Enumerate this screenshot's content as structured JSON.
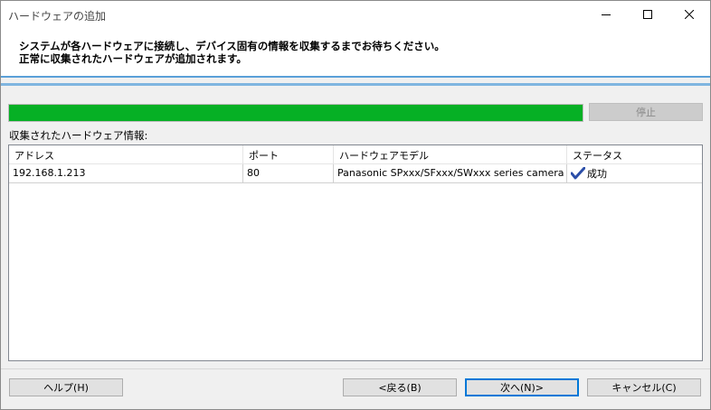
{
  "window": {
    "title": "ハードウェアの追加"
  },
  "header": {
    "line1": "システムが各ハードウェアに接続し、デバイス固有の情報を収集するまでお待ちください。",
    "line2": "正常に収集されたハードウェアが追加されます。"
  },
  "progress": {
    "percent": 100,
    "color": "#06b025"
  },
  "stop_button": {
    "label": "停止",
    "enabled": false
  },
  "section_label": "収集されたハードウェア情報:",
  "table": {
    "columns": [
      "アドレス",
      "ポート",
      "ハードウェアモデル",
      "ステータス"
    ],
    "rows": [
      {
        "address": "192.168.1.213",
        "port": "80",
        "model": "Panasonic SPxxx/SFxxx/SWxxx series camera",
        "status": "成功",
        "status_icon": "checkmark-icon"
      }
    ]
  },
  "footer": {
    "help_label": "ヘルプ(H)",
    "back_label": "<戻る(B)",
    "next_label": "次へ(N)>",
    "cancel_label": "キャンセル(C)"
  }
}
